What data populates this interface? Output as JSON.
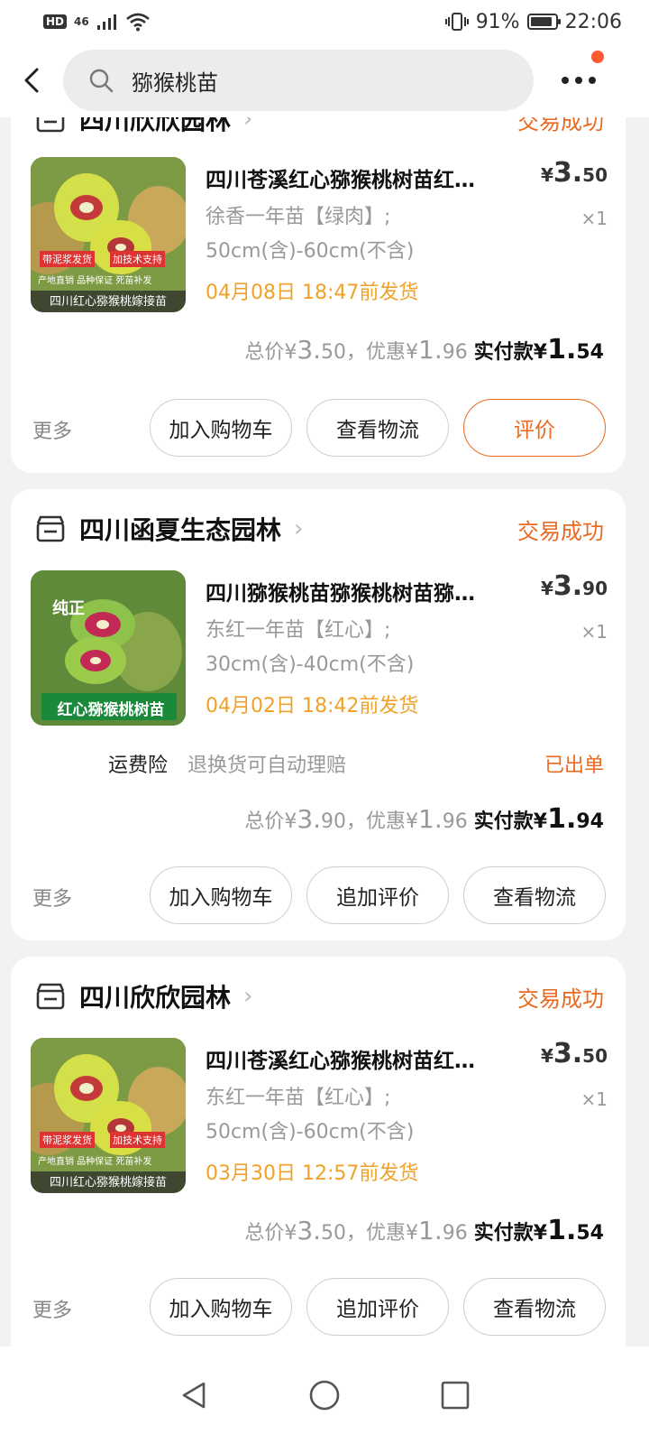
{
  "status_bar": {
    "signal": "46",
    "battery": "91%",
    "battery_level": 0.91,
    "time": "22:06",
    "hd": "HD"
  },
  "search": {
    "query": "猕猴桃苗"
  },
  "orders": [
    {
      "shop": "四川欣欣园林",
      "status": "交易成功",
      "title": "四川苍溪红心猕猴桃树苗红…",
      "price_symbol": "¥",
      "price_int": "3.",
      "price_dec": "50",
      "spec_line1": "徐香一年苗【绿肉】;",
      "spec_line2": "50cm(含)-60cm(不含)",
      "qty": "×1",
      "ship": "04月08日 18:47前发货",
      "total_label": "总价¥",
      "total_int": "3.",
      "total_dec": "50",
      "discount_label": "，优惠¥",
      "discount_int": "1.",
      "discount_dec": "96",
      "pay_label": "实付款",
      "pay_symbol": "¥",
      "pay_int": "1.",
      "pay_dec": "54",
      "more": "更多",
      "buttons": [
        "加入购物车",
        "查看物流",
        "评价"
      ],
      "thumb_caption": "四川红心猕猴桃嫁接苗",
      "thumb_tags": [
        "带泥浆发货",
        "加技术支持"
      ],
      "thumb_tags2": "产地直销 品种保证 死苗补发"
    },
    {
      "shop": "四川函夏生态园林",
      "status": "交易成功",
      "title": "四川猕猴桃苗猕猴桃树苗猕…",
      "price_symbol": "¥",
      "price_int": "3.",
      "price_dec": "90",
      "spec_line1": "东红一年苗【红心】;",
      "spec_line2": "30cm(含)-40cm(不含)",
      "qty": "×1",
      "ship": "04月02日 18:42前发货",
      "insurance": "运费险",
      "insurance_desc": "退换货可自动理赔",
      "insurance_status": "已出单",
      "total_label": "总价¥",
      "total_int": "3.",
      "total_dec": "90",
      "discount_label": "，优惠¥",
      "discount_int": "1.",
      "discount_dec": "96",
      "pay_label": "实付款",
      "pay_symbol": "¥",
      "pay_int": "1.",
      "pay_dec": "94",
      "more": "更多",
      "buttons": [
        "加入购物车",
        "追加评价",
        "查看物流"
      ],
      "thumb_badge": "纯正",
      "thumb_caption": "红心猕猴桃树苗"
    },
    {
      "shop": "四川欣欣园林",
      "status": "交易成功",
      "title": "四川苍溪红心猕猴桃树苗红…",
      "price_symbol": "¥",
      "price_int": "3.",
      "price_dec": "50",
      "spec_line1": "东红一年苗【红心】;",
      "spec_line2": "50cm(含)-60cm(不含)",
      "qty": "×1",
      "ship": "03月30日 12:57前发货",
      "total_label": "总价¥",
      "total_int": "3.",
      "total_dec": "50",
      "discount_label": "，优惠¥",
      "discount_int": "1.",
      "discount_dec": "96",
      "pay_label": "实付款",
      "pay_symbol": "¥",
      "pay_int": "1.",
      "pay_dec": "54",
      "more": "更多",
      "buttons": [
        "加入购物车",
        "追加评价",
        "查看物流"
      ],
      "thumb_caption": "四川红心猕猴桃嫁接苗",
      "thumb_tags": [
        "带泥浆发货",
        "加技术支持"
      ],
      "thumb_tags2": "产地直销 品种保证 死苗补发"
    }
  ],
  "colors": {
    "accent": "#ea6a21",
    "ship_orange": "#f0a12a",
    "notification": "#ff5b30"
  }
}
